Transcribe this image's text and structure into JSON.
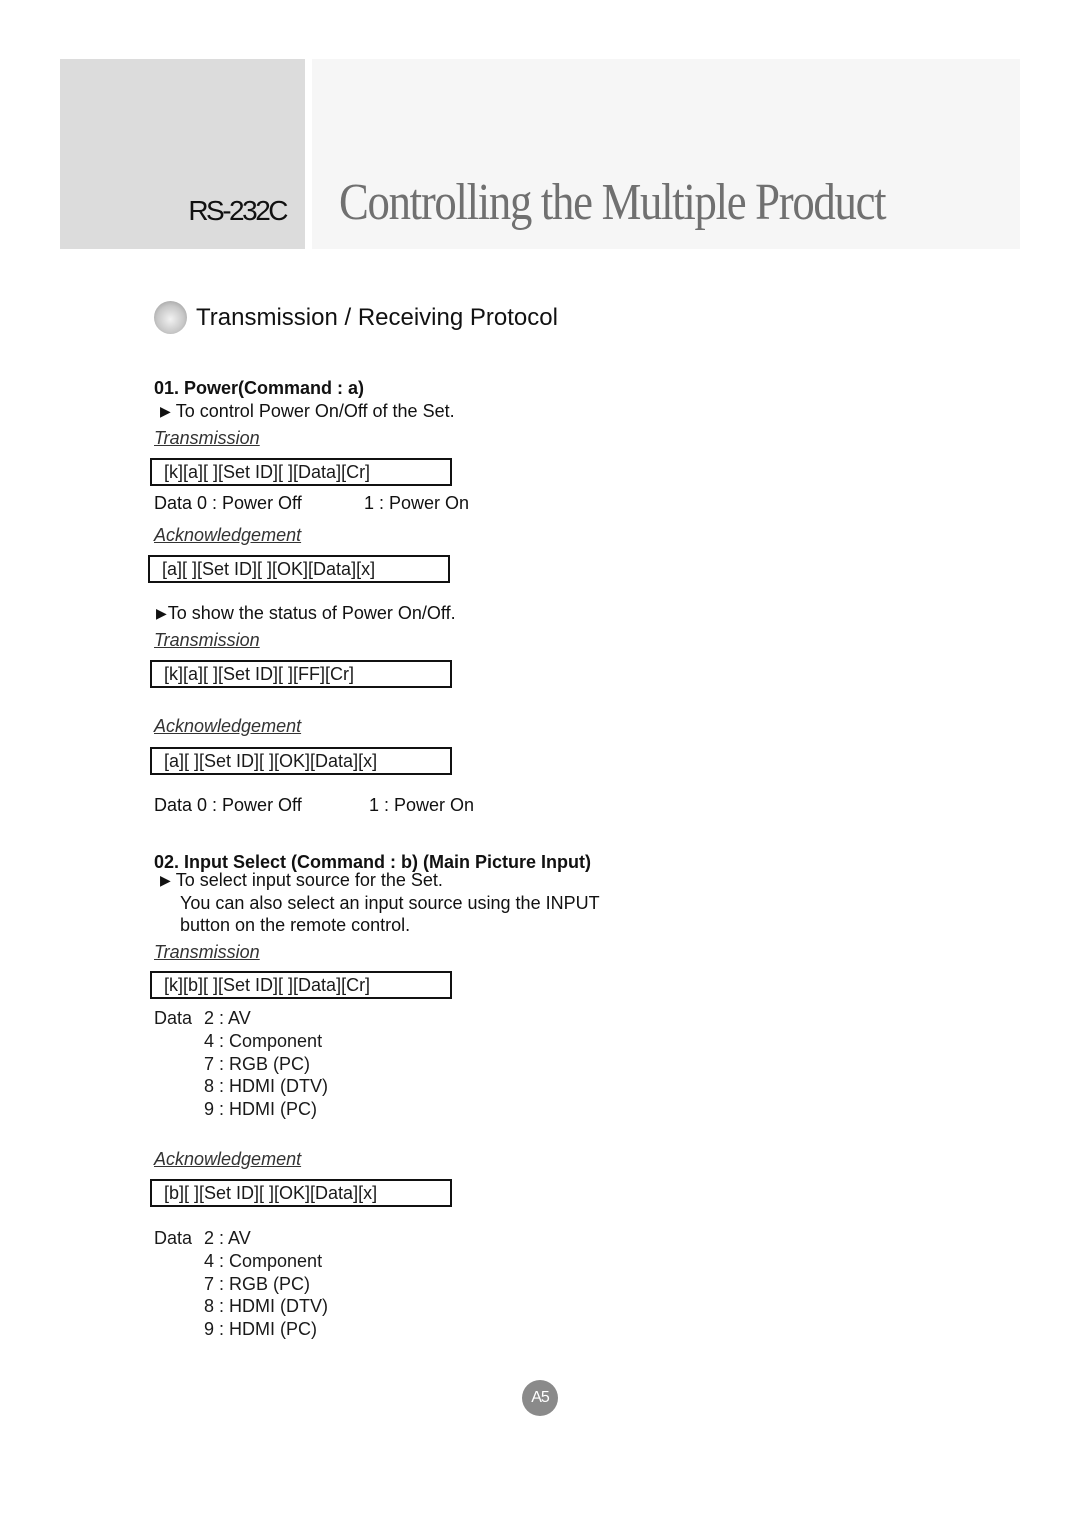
{
  "header": {
    "code": "RS-232C",
    "title": "Controlling the Multiple Product"
  },
  "section": {
    "title": "Transmission / Receiving Protocol"
  },
  "commands": [
    {
      "heading": "01. Power(Command : a)",
      "note1": "To control Power On/Off of the Set.",
      "transmission_label": "Transmission",
      "transmission": "[k][a][ ][Set ID][ ][Data][Cr]",
      "data_off": "Data 0 : Power Off",
      "data_on": "1 : Power On",
      "ack_label": "Acknowledgement",
      "ack": "[a][ ][Set ID][ ][OK][Data][x]",
      "note2": "To show the status of Power On/Off.",
      "transmission2_label": "Transmission",
      "transmission2": "[k][a][ ][Set ID][ ][FF][Cr]",
      "ack2_label": "Acknowledgement",
      "ack2": "[a][ ][Set ID][ ][OK][Data][x]",
      "data2_off": "Data 0 : Power Off",
      "data2_on": "1 : Power On"
    },
    {
      "heading": "02. Input Select (Command : b) (Main Picture Input)",
      "note_line1": "To select input source for the Set.",
      "note_line2": "You can also select an input source using the INPUT",
      "note_line3": "button on the remote control.",
      "transmission_label": "Transmission",
      "transmission": "[k][b][ ][Set ID][ ][Data][Cr]",
      "data_label": "Data",
      "data_values": [
        "2 : AV",
        "4 : Component",
        "7 : RGB (PC)",
        "8 : HDMI (DTV)",
        "9 : HDMI (PC)"
      ],
      "ack_label": "Acknowledgement",
      "ack": "[b][ ][Set ID][ ][OK][Data][x]",
      "ack_data_label": "Data",
      "ack_data_values": [
        "2 : AV",
        "4 : Component",
        "7 : RGB (PC)",
        "8 : HDMI (DTV)",
        "9 : HDMI (PC)"
      ]
    }
  ],
  "arrow_icon": "▶",
  "page_number": "A5"
}
